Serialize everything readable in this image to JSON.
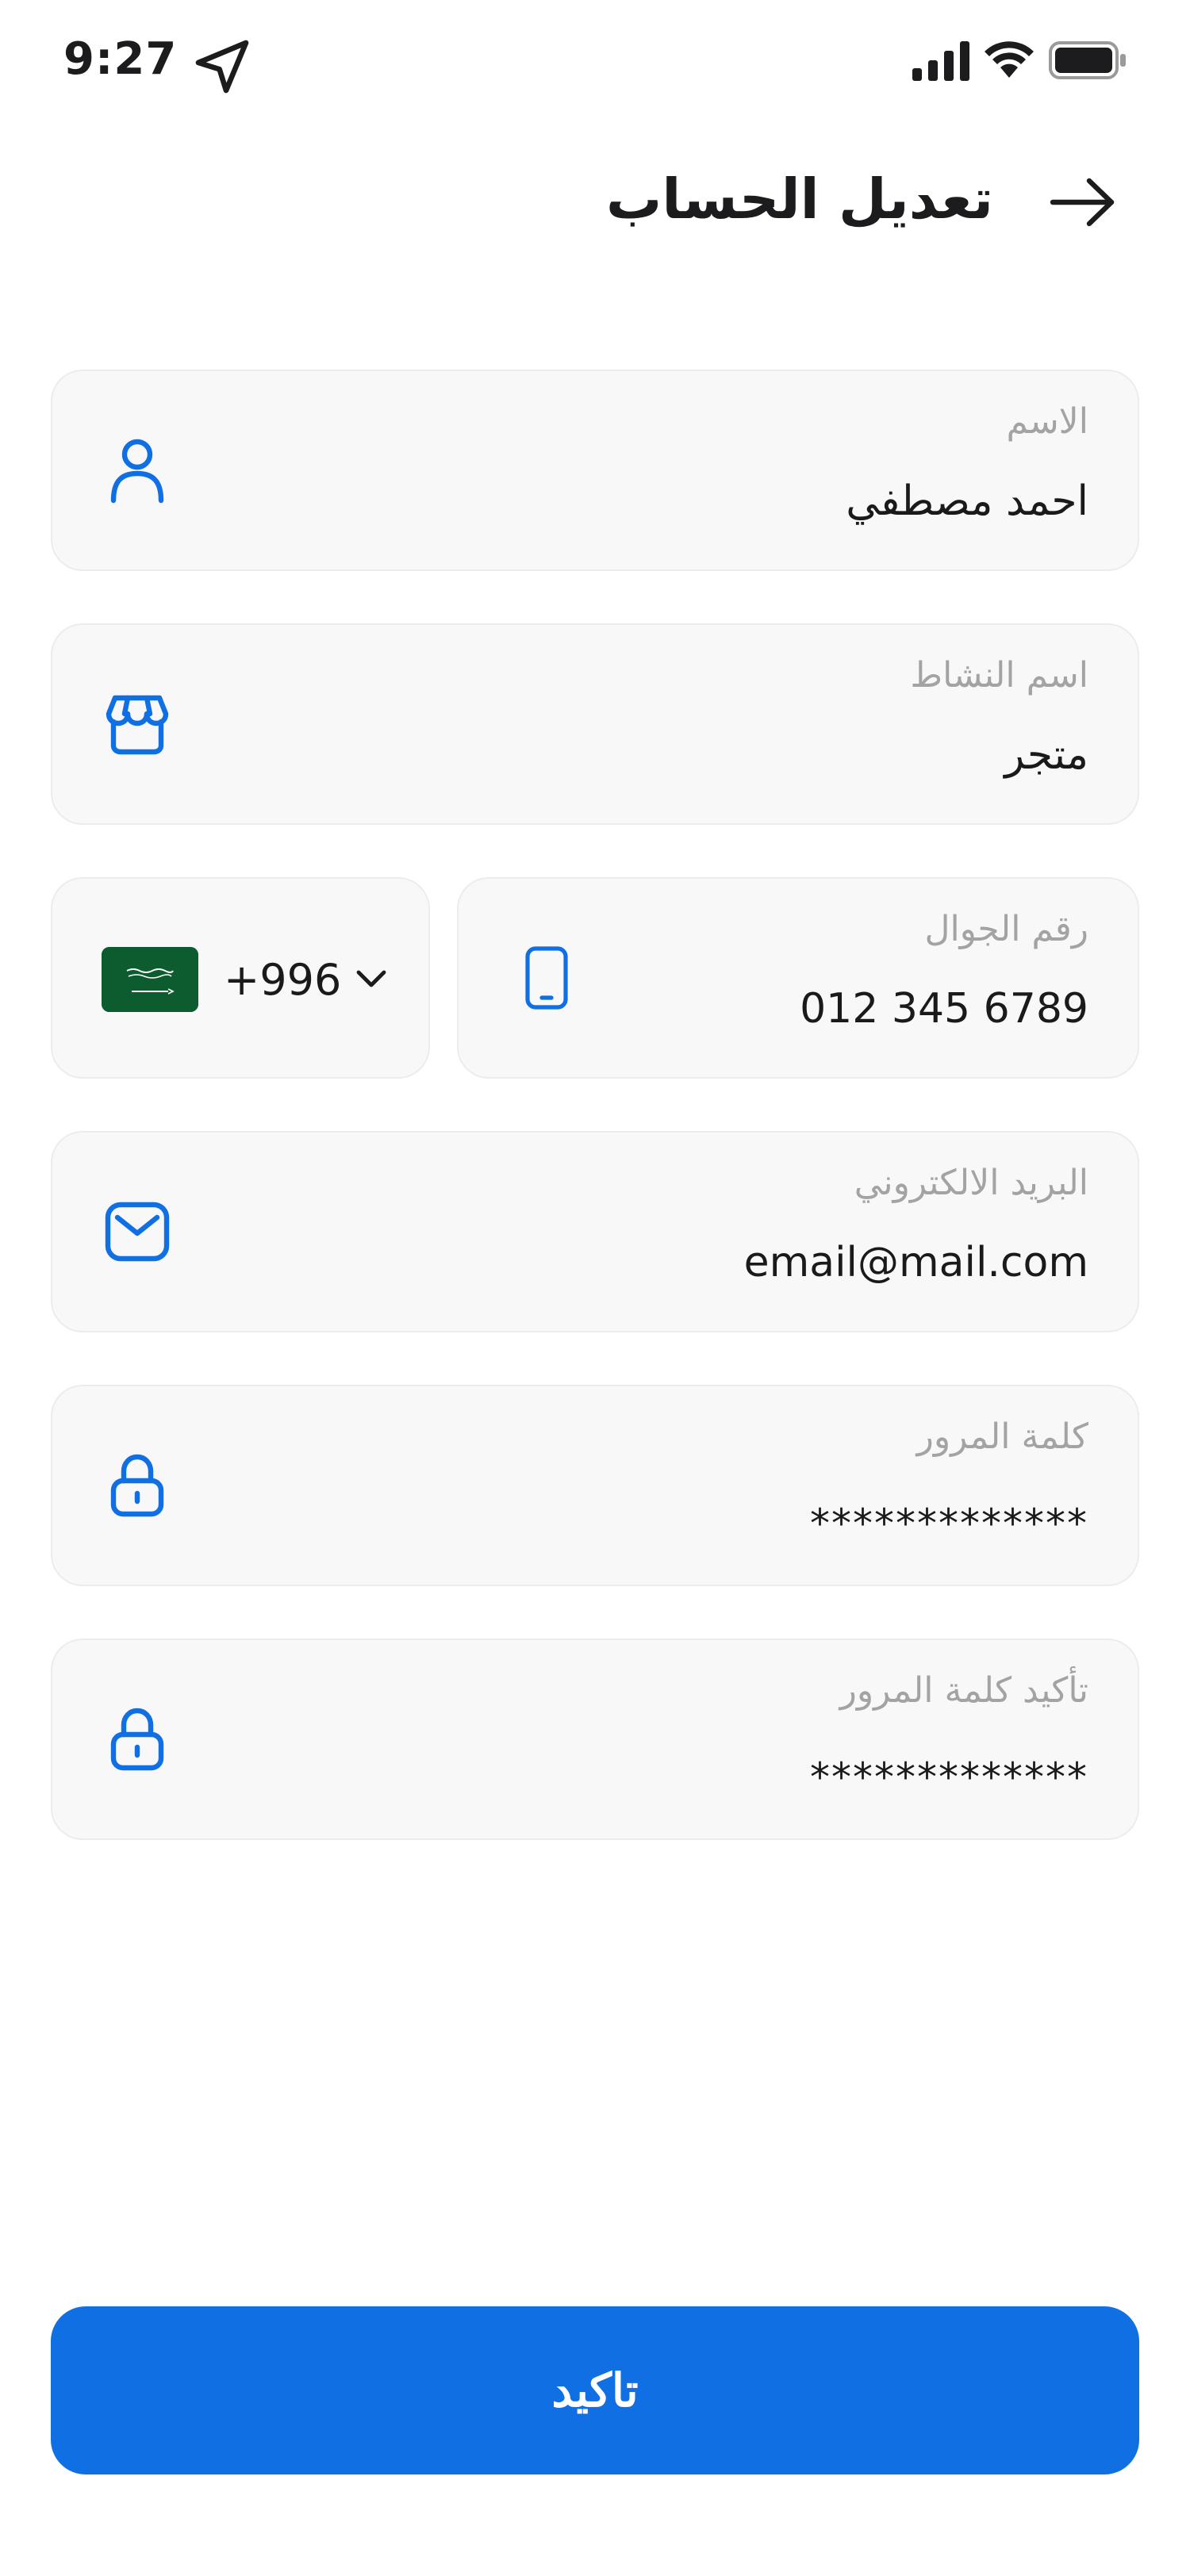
{
  "status_bar": {
    "time": "9:27",
    "icons": [
      "location-arrow-icon",
      "cellular-signal-icon",
      "wifi-icon",
      "battery-icon"
    ]
  },
  "header": {
    "title": "تعديل الحساب",
    "back_icon": "arrow-right-icon"
  },
  "form": {
    "name": {
      "label": "الاسم",
      "value": "احمد مصطفي",
      "icon": "user-icon"
    },
    "business": {
      "label": "اسم النشاط",
      "value": "متجر",
      "icon": "store-icon"
    },
    "phone": {
      "label": "رقم الجوال",
      "value": "012 345 6789",
      "icon": "smartphone-icon",
      "country_code": "+996",
      "country_flag": "saudi-arabia-flag-icon"
    },
    "email": {
      "label": "البريد الالكتروني",
      "value": "email@mail.com",
      "icon": "mail-icon"
    },
    "password": {
      "label": "كلمة المرور",
      "value": "*************",
      "icon": "lock-icon"
    },
    "password_confirm": {
      "label": "تأكيد كلمة المرور",
      "value": "*************",
      "icon": "lock-icon"
    }
  },
  "confirm_label": "تاكيد",
  "colors": {
    "accent": "#0F6FE3",
    "field_bg": "#F8F8F8",
    "field_border": "#ECECEC",
    "label": "#A3A3A3",
    "text": "#1A1A1A",
    "flag_green": "#0D5C30"
  }
}
